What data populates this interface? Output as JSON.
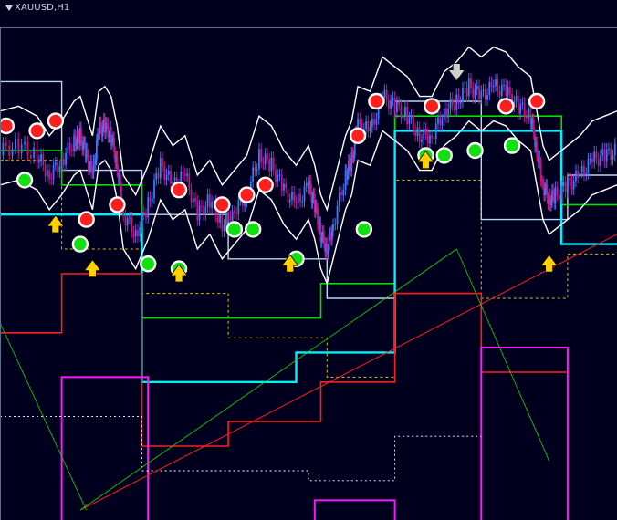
{
  "window": {
    "title": "XAUUSD,H1",
    "collapse_icon": "triangle-down-icon"
  },
  "colors": {
    "background": "#00001e",
    "bull_candle": "#3a78ff",
    "bear_candle": "#c8157e",
    "resistance_outer": "#b8d8f0",
    "resistance_outer_dotted": "#e0c400",
    "envelope": "#ffffff",
    "support_green": "#00e000",
    "pivot_cyan": "#00f0ff",
    "support_red": "#ff1e1e",
    "support_magenta": "#ff18ff",
    "lower_dotted": "#ffffff",
    "sell_marker": "#ff1e1e",
    "buy_marker": "#10e010",
    "arrow_up": "#ffd000",
    "arrow_down": "#d0d0d0"
  },
  "chart_data": {
    "type": "candlestick-with-indicators",
    "symbol": "XAUUSD",
    "timeframe": "H1",
    "grid": false,
    "ylim": [
      0,
      100
    ],
    "xlim": [
      0,
      100
    ],
    "close_path": [
      [
        0,
        75
      ],
      [
        3,
        76
      ],
      [
        6,
        74
      ],
      [
        8,
        70
      ],
      [
        10,
        73
      ],
      [
        12,
        77
      ],
      [
        13,
        78
      ],
      [
        14,
        74
      ],
      [
        15,
        70
      ],
      [
        16,
        79
      ],
      [
        17,
        80
      ],
      [
        18,
        78
      ],
      [
        19,
        72
      ],
      [
        20,
        62
      ],
      [
        22,
        58
      ],
      [
        24,
        64
      ],
      [
        26,
        72
      ],
      [
        28,
        68
      ],
      [
        30,
        70
      ],
      [
        32,
        62
      ],
      [
        34,
        65
      ],
      [
        36,
        60
      ],
      [
        38,
        63
      ],
      [
        40,
        66
      ],
      [
        42,
        74
      ],
      [
        44,
        72
      ],
      [
        46,
        67
      ],
      [
        48,
        64
      ],
      [
        50,
        68
      ],
      [
        51,
        64
      ],
      [
        52,
        58
      ],
      [
        53,
        55
      ],
      [
        54,
        60
      ],
      [
        56,
        70
      ],
      [
        57,
        73
      ],
      [
        58,
        80
      ],
      [
        60,
        79
      ],
      [
        62,
        86
      ],
      [
        64,
        84
      ],
      [
        66,
        82
      ],
      [
        68,
        78
      ],
      [
        70,
        78
      ],
      [
        72,
        83
      ],
      [
        74,
        85
      ],
      [
        76,
        88
      ],
      [
        78,
        86
      ],
      [
        80,
        88
      ],
      [
        82,
        87
      ],
      [
        84,
        84
      ],
      [
        86,
        82
      ],
      [
        87,
        75
      ],
      [
        88,
        68
      ],
      [
        89,
        65
      ],
      [
        90,
        66
      ],
      [
        92,
        68
      ],
      [
        94,
        70
      ],
      [
        96,
        73
      ],
      [
        98,
        74
      ],
      [
        100,
        75
      ]
    ],
    "sell_signals": [
      [
        1,
        80
      ],
      [
        6,
        79
      ],
      [
        9,
        81
      ],
      [
        14,
        61
      ],
      [
        19,
        64
      ],
      [
        29,
        67
      ],
      [
        36,
        64
      ],
      [
        40,
        66
      ],
      [
        43,
        68
      ],
      [
        58,
        78
      ],
      [
        61,
        85
      ],
      [
        70,
        84
      ],
      [
        82,
        84
      ],
      [
        87,
        85
      ]
    ],
    "buy_signals": [
      [
        4,
        69
      ],
      [
        13,
        56
      ],
      [
        24,
        52
      ],
      [
        29,
        51
      ],
      [
        38,
        59
      ],
      [
        41,
        59
      ],
      [
        48,
        53
      ],
      [
        59,
        59
      ],
      [
        69,
        74
      ],
      [
        72,
        74
      ],
      [
        77,
        75
      ],
      [
        83,
        76
      ]
    ],
    "up_arrows": [
      [
        9,
        60
      ],
      [
        15,
        51
      ],
      [
        29,
        50
      ],
      [
        47,
        52
      ],
      [
        69,
        73
      ],
      [
        89,
        52
      ]
    ],
    "down_arrows": [
      [
        74,
        91
      ]
    ],
    "resistance_outer": [
      [
        0,
        89
      ],
      [
        10,
        89
      ],
      [
        10,
        71
      ],
      [
        23,
        71
      ],
      [
        23,
        62
      ],
      [
        37,
        62
      ],
      [
        37,
        53
      ],
      [
        53,
        53
      ],
      [
        53,
        45
      ],
      [
        64,
        45
      ],
      [
        64,
        85
      ],
      [
        78,
        85
      ],
      [
        78,
        61
      ],
      [
        92,
        61
      ],
      [
        92,
        70
      ],
      [
        100,
        70
      ]
    ]
  }
}
